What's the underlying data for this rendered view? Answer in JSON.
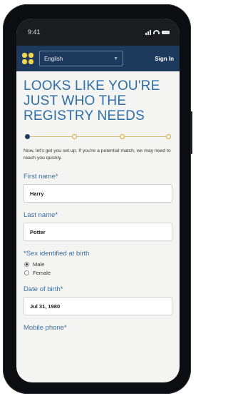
{
  "status_bar": {
    "time": "9:41"
  },
  "header": {
    "logo_icon": "registry-logo-icon",
    "language": "English",
    "sign_in": "Sign In"
  },
  "heading": "LOOKS LIKE YOU'RE JUST WHO THE REGISTRY NEEDS",
  "progress": {
    "current_step": 1,
    "total_steps": 4
  },
  "intro": "Now, let's get you set up. If you're a potential match, we may need to reach you quickly.",
  "form": {
    "first_name_label": "First name*",
    "first_name_value": "Harry",
    "last_name_label": "Last name*",
    "last_name_value": "Potter",
    "sex_label": "*Sex identified at birth",
    "sex_options": [
      "Male",
      "Female"
    ],
    "sex_selected": "Male",
    "dob_label": "Date of birth*",
    "dob_value": "Jul 31, 1980",
    "mobile_label": "Mobile phone*"
  },
  "colors": {
    "header_bg": "#1d3a5c",
    "heading": "#2f6ea6",
    "logo": "#f2d54a",
    "progress": "#d8a92d"
  }
}
